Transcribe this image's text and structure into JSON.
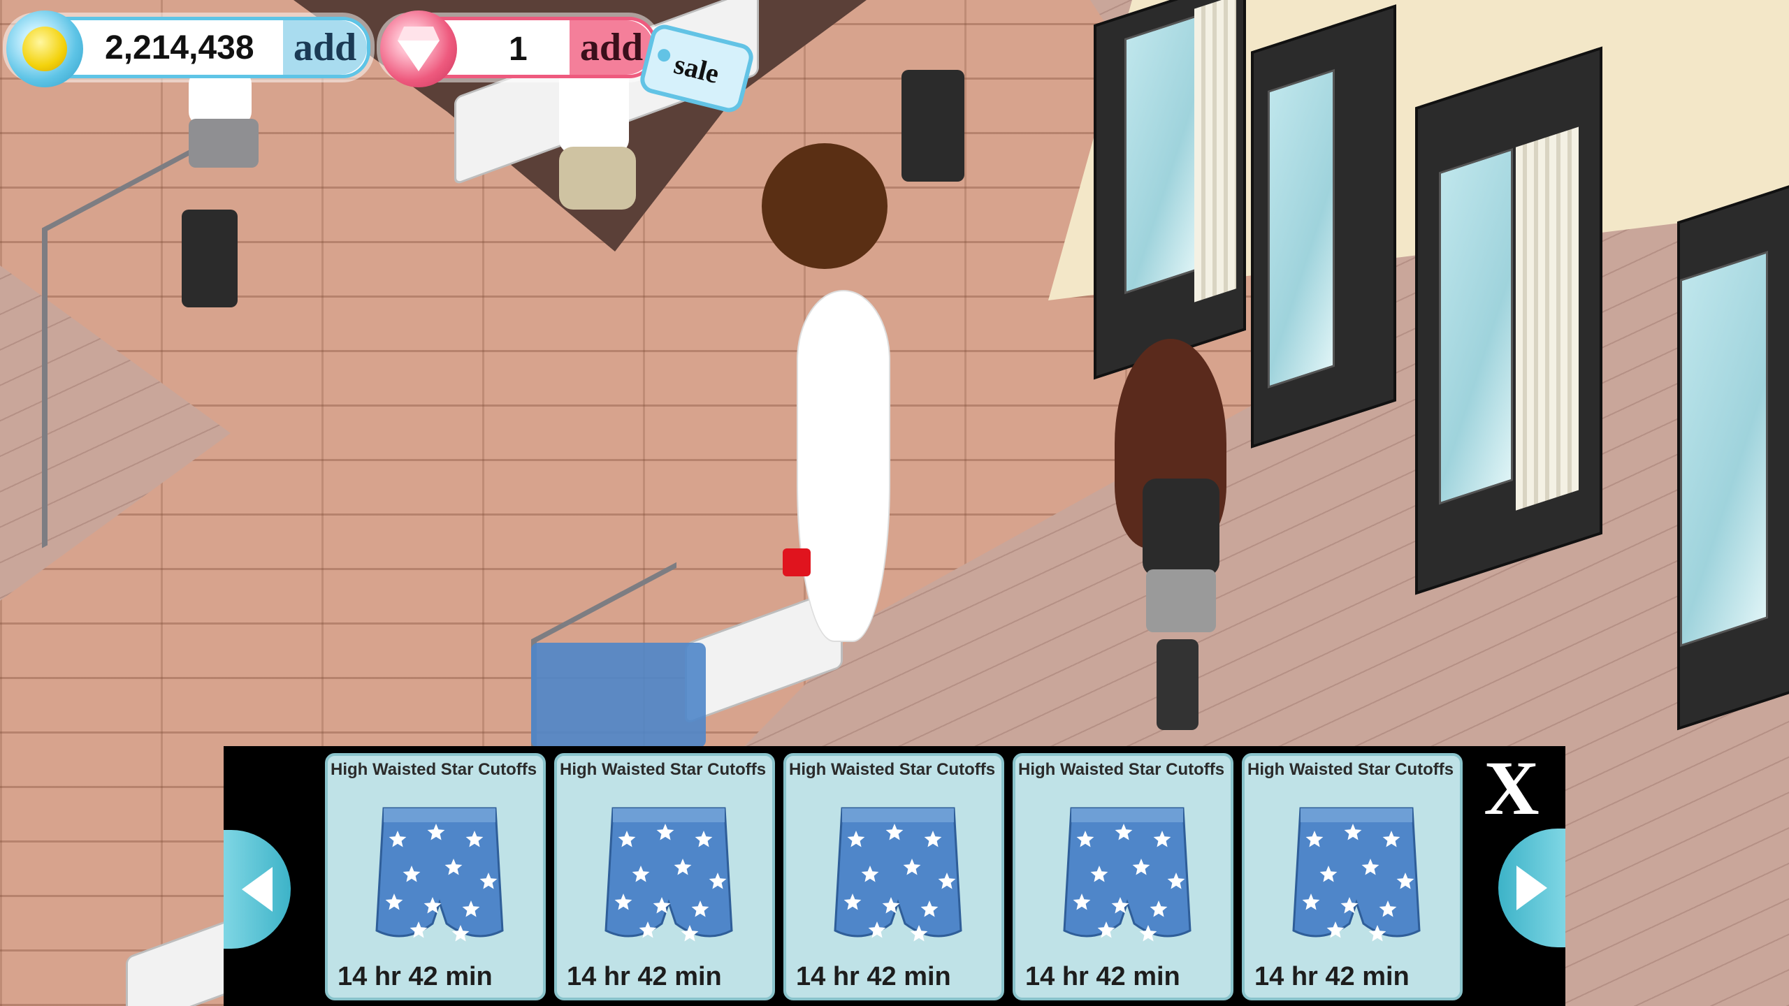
{
  "hud": {
    "coins": {
      "value": "2,214,438",
      "add_label": "add",
      "icon": "coin-icon",
      "accent": "#5ec4e6"
    },
    "gems": {
      "value": "1",
      "add_label": "add",
      "icon": "gem-icon",
      "accent": "#ee5a7e"
    },
    "sale_label": "sale"
  },
  "tray": {
    "close_label": "X",
    "items": [
      {
        "title": "High Waisted Star Cutoffs",
        "timer": "14 hr 42 min",
        "icon": "star-shorts-icon"
      },
      {
        "title": "High Waisted Star Cutoffs",
        "timer": "14 hr 42 min",
        "icon": "star-shorts-icon"
      },
      {
        "title": "High Waisted Star Cutoffs",
        "timer": "14 hr 42 min",
        "icon": "star-shorts-icon"
      },
      {
        "title": "High Waisted Star Cutoffs",
        "timer": "14 hr 42 min",
        "icon": "star-shorts-icon"
      },
      {
        "title": "High Waisted Star Cutoffs",
        "timer": "14 hr 42 min",
        "icon": "star-shorts-icon"
      }
    ]
  },
  "colors": {
    "brick_floor": "#d7a38d",
    "wood_floor": "#c9a69a",
    "tray_background": "#000000",
    "card_background": "#bfe2e7",
    "shorts_denim": "#4f86c9"
  }
}
